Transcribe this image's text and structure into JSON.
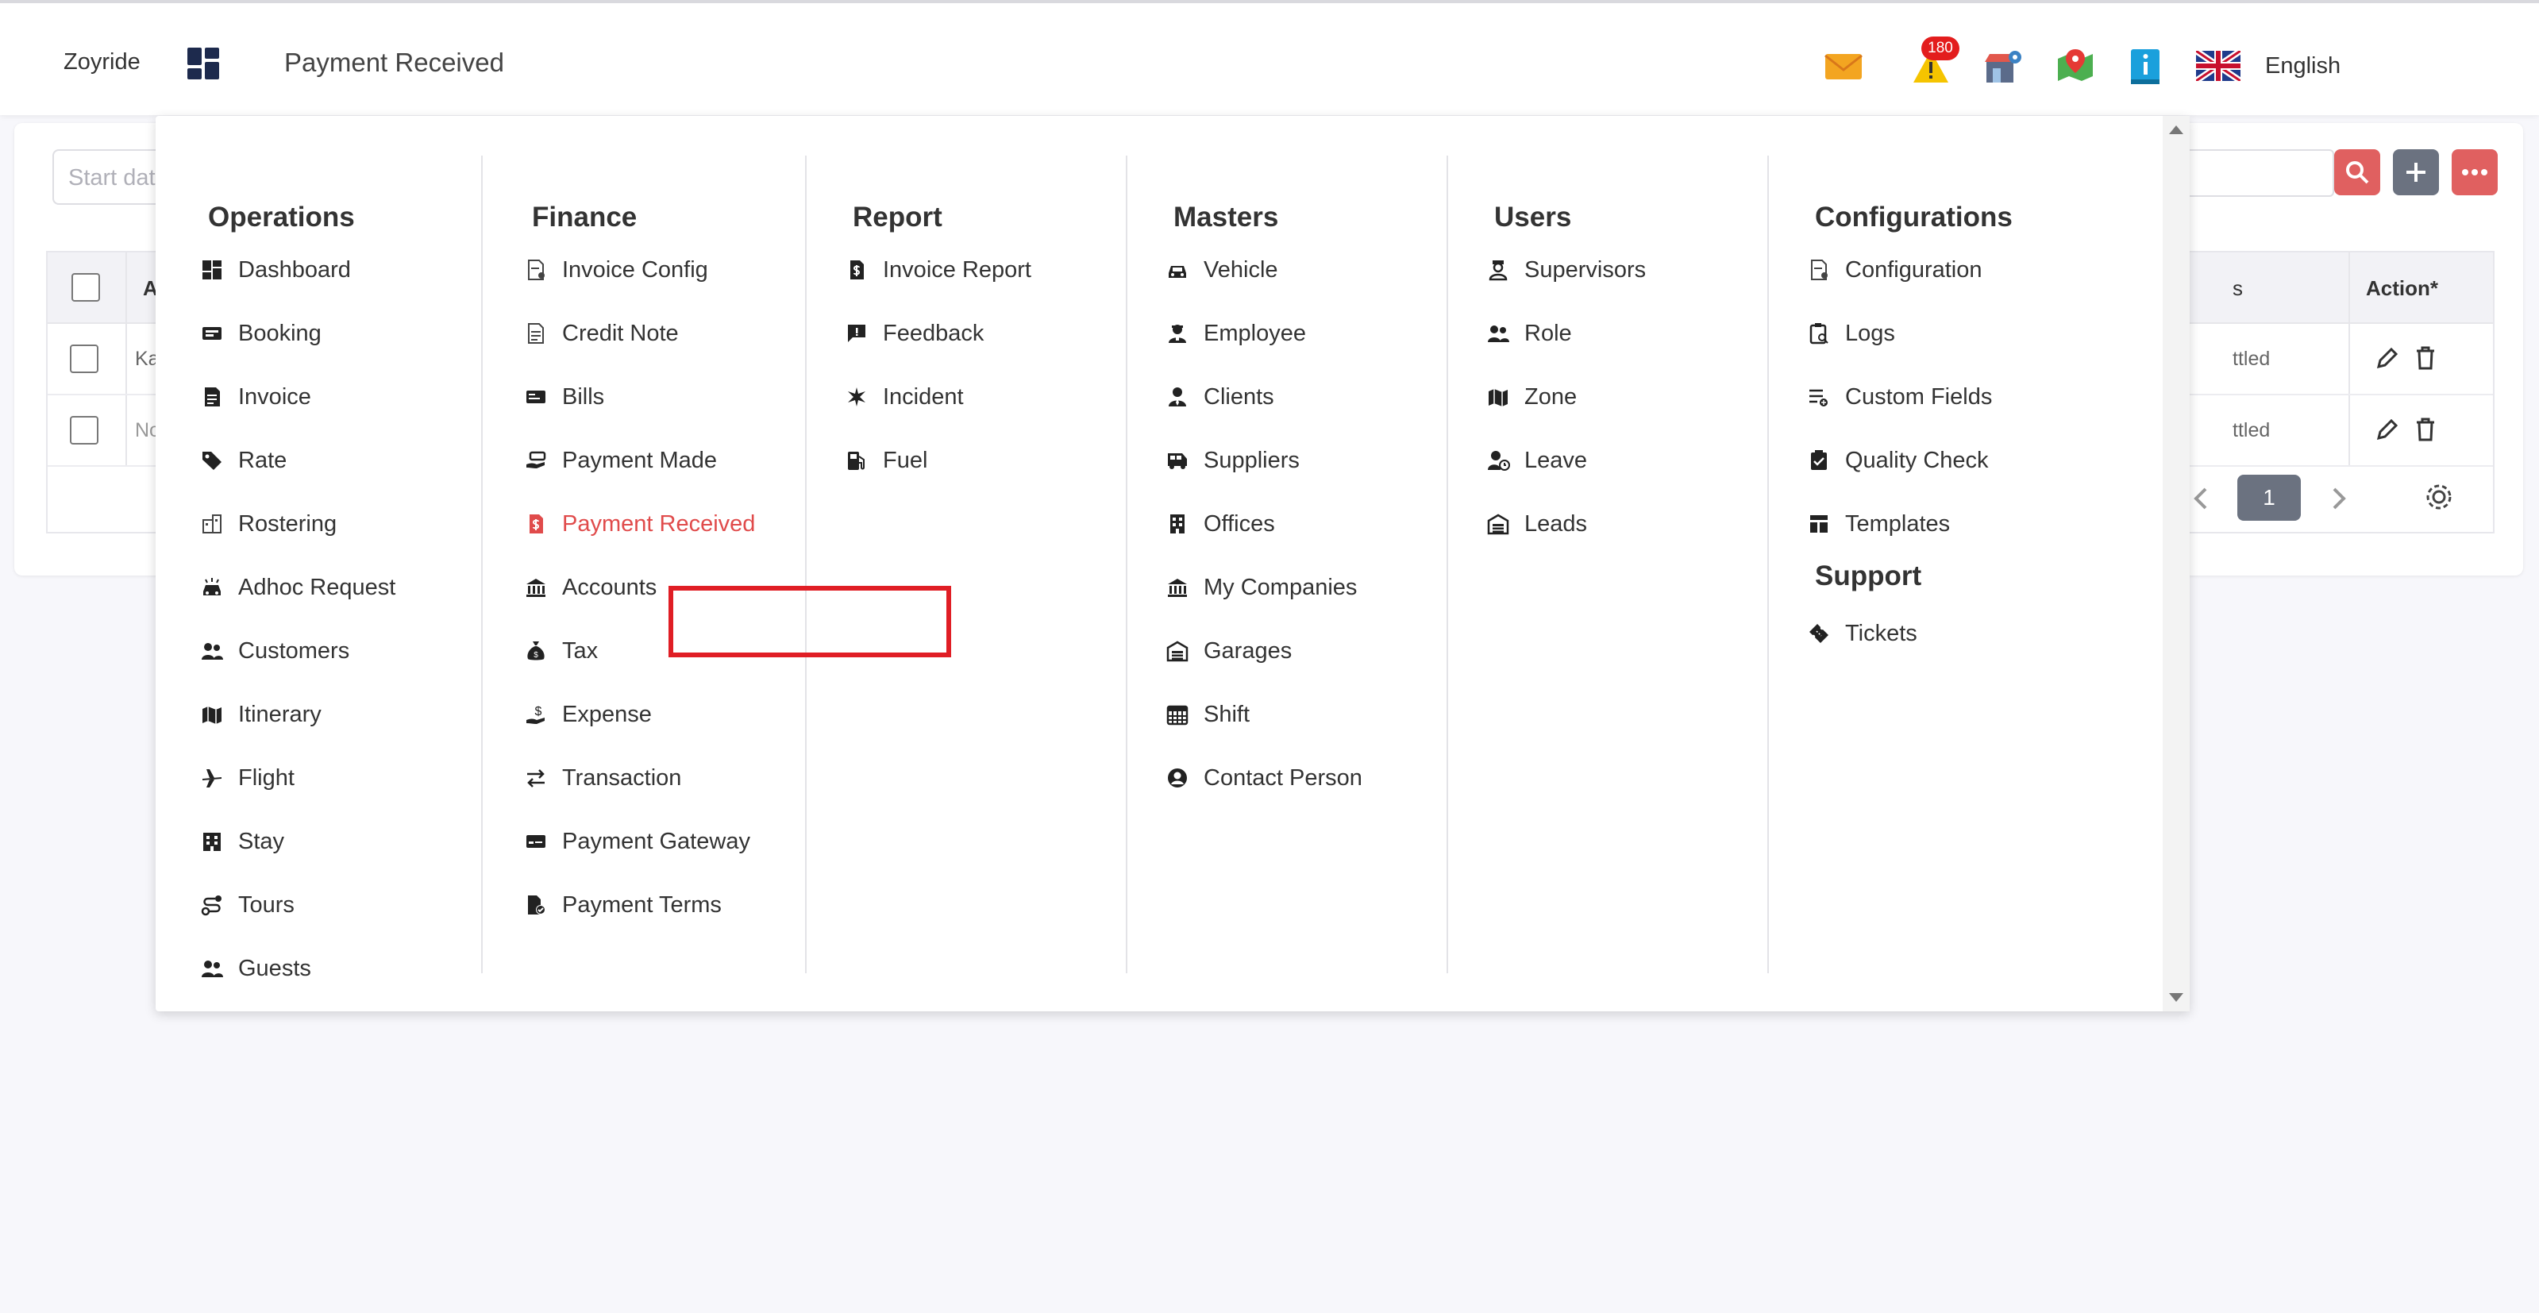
{
  "header": {
    "brand": "Zoyride",
    "page_title": "Payment Received",
    "alert_count": "180",
    "language": "English"
  },
  "content": {
    "date_placeholder": "Start date",
    "table": {
      "col_a": "A",
      "col_status": "s",
      "col_action": "Action*",
      "rows": [
        {
          "first": "Ka",
          "status": "ttled"
        },
        {
          "first": "No",
          "status": "ttled"
        }
      ]
    },
    "page": "1"
  },
  "menu": {
    "columns": [
      {
        "title": "Operations",
        "items": [
          {
            "label": "Dashboard",
            "icon": "dashboard-icon"
          },
          {
            "label": "Booking",
            "icon": "booking-icon"
          },
          {
            "label": "Invoice",
            "icon": "invoice-icon"
          },
          {
            "label": "Rate",
            "icon": "tag-icon"
          },
          {
            "label": "Rostering",
            "icon": "rostering-icon"
          },
          {
            "label": "Adhoc Request",
            "icon": "car-alert-icon"
          },
          {
            "label": "Customers",
            "icon": "people-icon"
          },
          {
            "label": "Itinerary",
            "icon": "map-icon"
          },
          {
            "label": "Flight",
            "icon": "plane-icon"
          },
          {
            "label": "Stay",
            "icon": "building-icon"
          },
          {
            "label": "Tours",
            "icon": "route-icon"
          },
          {
            "label": "Guests",
            "icon": "people-icon"
          }
        ]
      },
      {
        "title": "Finance",
        "items": [
          {
            "label": "Invoice Config",
            "icon": "doc-gear-icon"
          },
          {
            "label": "Credit Note",
            "icon": "doc-icon"
          },
          {
            "label": "Bills",
            "icon": "bill-icon"
          },
          {
            "label": "Payment Made",
            "icon": "hand-cash-icon"
          },
          {
            "label": "Payment Received",
            "icon": "dollar-doc-icon"
          },
          {
            "label": "Accounts",
            "icon": "bank-icon"
          },
          {
            "label": "Tax",
            "icon": "money-bag-icon"
          },
          {
            "label": "Expense",
            "icon": "hand-dollar-icon"
          },
          {
            "label": "Transaction",
            "icon": "swap-icon"
          },
          {
            "label": "Payment Gateway",
            "icon": "card-icon"
          },
          {
            "label": "Payment Terms",
            "icon": "doc-check-icon"
          }
        ]
      },
      {
        "title": "Report",
        "items": [
          {
            "label": "Invoice Report",
            "icon": "dollar-doc-icon"
          },
          {
            "label": "Feedback",
            "icon": "feedback-icon"
          },
          {
            "label": "Incident",
            "icon": "incident-icon"
          },
          {
            "label": "Fuel",
            "icon": "fuel-icon"
          }
        ]
      },
      {
        "title": "Masters",
        "items": [
          {
            "label": "Vehicle",
            "icon": "car-icon"
          },
          {
            "label": "Employee",
            "icon": "employee-icon"
          },
          {
            "label": "Clients",
            "icon": "client-icon"
          },
          {
            "label": "Suppliers",
            "icon": "van-icon"
          },
          {
            "label": "Offices",
            "icon": "office-icon"
          },
          {
            "label": "My Companies",
            "icon": "bank-icon"
          },
          {
            "label": "Garages",
            "icon": "garage-icon"
          },
          {
            "label": "Shift",
            "icon": "calendar-icon"
          },
          {
            "label": "Contact Person",
            "icon": "user-circle-icon"
          }
        ]
      },
      {
        "title": "Users",
        "items": [
          {
            "label": "Supervisors",
            "icon": "supervisor-icon"
          },
          {
            "label": "Role",
            "icon": "people-icon"
          },
          {
            "label": "Zone",
            "icon": "map-icon"
          },
          {
            "label": "Leave",
            "icon": "user-clock-icon"
          },
          {
            "label": "Leads",
            "icon": "garage-icon"
          }
        ]
      },
      {
        "title": "Configurations",
        "items": [
          {
            "label": "Configuration",
            "icon": "doc-gear-icon"
          },
          {
            "label": "Logs",
            "icon": "clipboard-search-icon"
          },
          {
            "label": "Custom Fields",
            "icon": "list-add-icon"
          },
          {
            "label": "Quality Check",
            "icon": "clipboard-check-icon"
          },
          {
            "label": "Templates",
            "icon": "template-icon"
          }
        ],
        "sub_title": "Support",
        "sub_items": [
          {
            "label": "Tickets",
            "icon": "ticket-icon"
          }
        ]
      }
    ],
    "active_item": "Payment Received"
  },
  "colors": {
    "accent_red": "#e04b4b",
    "highlight_border": "#e01e25",
    "brand_navy": "#1d2a4d"
  }
}
